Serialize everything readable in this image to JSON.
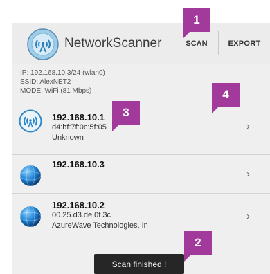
{
  "app": {
    "title": "NetworkScanner",
    "icon": "wifi-antenna-icon"
  },
  "actionbar": {
    "scan_label": "SCAN",
    "export_label": "EXPORT"
  },
  "info": {
    "ip": "IP: 192.168.10.3/24 (wlan0)",
    "ssid": "SSID: AlexNET2",
    "mode": "MODE: WiFi (81 Mbps)"
  },
  "devices": [
    {
      "ip": "192.168.10.1",
      "mac": "d4:bf:7f:0c:5f:05",
      "vendor": "Unknown",
      "icon": "router-wifi-icon"
    },
    {
      "ip": "192.168.10.3",
      "icon": "globe-icon"
    },
    {
      "ip": "192.168.10.2",
      "mac": "00.25.d3.de.0f.3c",
      "vendor": "AzureWave Technologies, In",
      "icon": "globe-icon"
    }
  ],
  "chevron": "›",
  "toast": "Scan finished !",
  "callouts": [
    "1",
    "2",
    "3",
    "4"
  ],
  "colors": {
    "callout": "#a23a9b",
    "actionbar": "#ececec",
    "toast": "#262626"
  }
}
